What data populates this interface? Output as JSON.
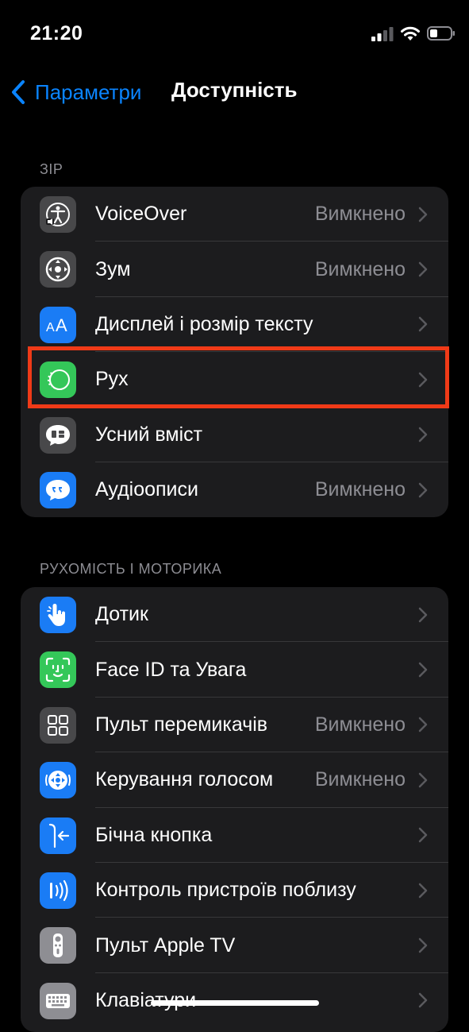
{
  "status_bar": {
    "time": "21:20"
  },
  "nav": {
    "back_label": "Параметри",
    "title": "Доступність"
  },
  "sections": [
    {
      "header": "ЗІР",
      "items": [
        {
          "label": "VoiceOver",
          "value": "Вимкнено",
          "icon": "voiceover-icon",
          "icon_bg": "#48484a"
        },
        {
          "label": "Зум",
          "value": "Вимкнено",
          "icon": "zoom-icon",
          "icon_bg": "#48484a"
        },
        {
          "label": "Дисплей і розмір тексту",
          "value": "",
          "icon": "text-size-icon",
          "icon_bg": "#1a7cf5"
        },
        {
          "label": "Рух",
          "value": "",
          "icon": "motion-icon",
          "icon_bg": "#34c759"
        },
        {
          "label": "Усний вміст",
          "value": "",
          "icon": "spoken-content-icon",
          "icon_bg": "#48484a"
        },
        {
          "label": "Аудіоописи",
          "value": "Вимкнено",
          "icon": "audio-descriptions-icon",
          "icon_bg": "#1a7cf5"
        }
      ]
    },
    {
      "header": "РУХОМІСТЬ І МОТОРИКА",
      "items": [
        {
          "label": "Дотик",
          "value": "",
          "icon": "touch-icon",
          "icon_bg": "#1a7cf5"
        },
        {
          "label": "Face ID та Увага",
          "value": "",
          "icon": "face-id-icon",
          "icon_bg": "#34c759"
        },
        {
          "label": "Пульт перемикачів",
          "value": "Вимкнено",
          "icon": "switch-control-icon",
          "icon_bg": "#48484a"
        },
        {
          "label": "Керування голосом",
          "value": "Вимкнено",
          "icon": "voice-control-icon",
          "icon_bg": "#1a7cf5"
        },
        {
          "label": "Бічна кнопка",
          "value": "",
          "icon": "side-button-icon",
          "icon_bg": "#1a7cf5"
        },
        {
          "label": "Контроль пристроїв поблизу",
          "value": "",
          "icon": "nearby-devices-icon",
          "icon_bg": "#1a7cf5"
        },
        {
          "label": "Пульт Apple TV",
          "value": "",
          "icon": "apple-tv-remote-icon",
          "icon_bg": "#8e8e93"
        },
        {
          "label": "Клавіатури",
          "value": "",
          "icon": "keyboard-icon",
          "icon_bg": "#8e8e93"
        }
      ]
    }
  ],
  "colors": {
    "accent": "#0a84ff",
    "highlight": "#f03a17",
    "group_bg": "#1c1c1e",
    "secondary_text": "#8d8d93"
  }
}
